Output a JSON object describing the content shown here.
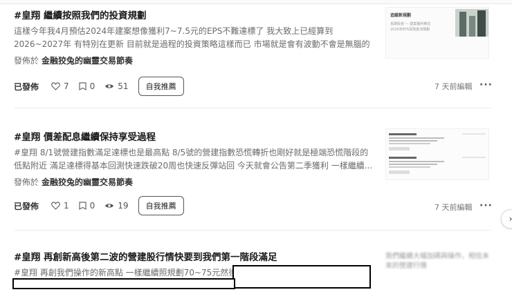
{
  "posts": [
    {
      "title": "#皇翔 繼續按照我們的投資規劃",
      "excerpt": "這樣今年我4月預估2024年建案想像獲利7~7.5元的EPS不難達標了 我大致上已經算到2026~2027年 有特別在更新 目前就是過程的投資策略這樣而已 市場就是會有波動不會是無腦的趨勢 因為市...",
      "published_in_label": "發佈於",
      "publication": "金融狡兔的幽靈交易節奏",
      "status": "已發佈",
      "likes": "7",
      "comments": "0",
      "views": "51",
      "promote_label": "自我推薦",
      "edited": "7 天前編輯",
      "more": "···",
      "thumb_heading": "追蹤新規劃",
      "thumb_lines": [
        "長期投資 — 建案獲利推估",
        "2026年EPS與現金流規劃"
      ]
    },
    {
      "title": "#皇翔 價差配息繼續保持享受過程",
      "excerpt": "#皇翔 8/1號營建指數滿足達標也是最高點 8/5號的營建指數恐慌轉折也剛好就是極端恐慌階段的低點附近 滿足達標得基本回測快速跌破20周也快速反彈站回 今天就會公告第二季獲利 一樣繼續...",
      "published_in_label": "發佈於",
      "publication": "金融狡兔的幽靈交易節奏",
      "status": "已發佈",
      "likes": "1",
      "comments": "0",
      "views": "19",
      "promote_label": "自我推薦",
      "edited": "7 天前編輯",
      "more": "···"
    },
    {
      "title": "#皇翔 再創新高後第二波的營建股行情快要到我們第一階段滿足",
      "excerpt": "#皇翔 再創我們操作的新高點 一樣繼續照規劃70~75元然後",
      "thumb_blur_text": "我們繼續大幅加碼與操作，相信未來的營建行情"
    }
  ],
  "scroll_arrow": "›",
  "colors": {
    "text": "#1a1a1a",
    "muted": "#6b6b6b",
    "border": "#555555"
  }
}
